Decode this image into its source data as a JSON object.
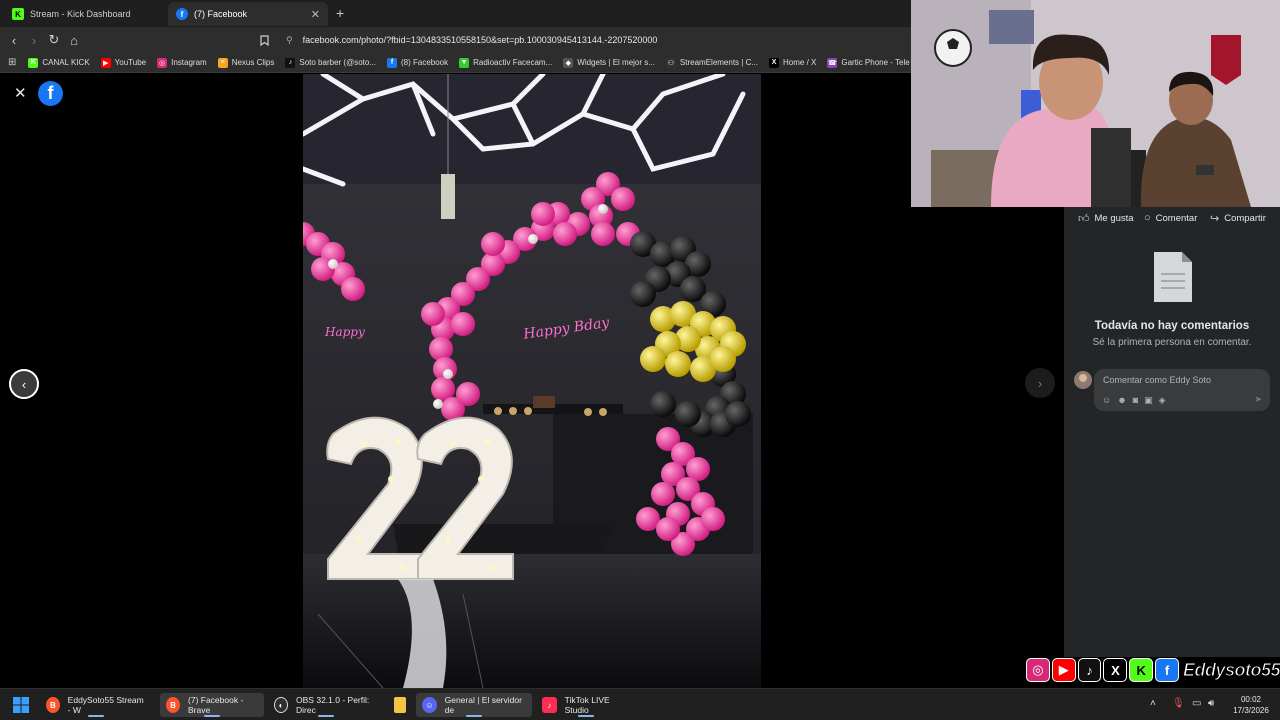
{
  "tabs": [
    {
      "label": "Stream - Kick Dashboard",
      "icon": "kick-icon",
      "color": "#53fc18"
    },
    {
      "label": "(7) Facebook",
      "icon": "facebook-icon",
      "color": "#1877f2"
    }
  ],
  "address": {
    "url": "facebook.com/photo/?fbid=1304833510558150&set=pb.100030945413144.-2207520000"
  },
  "bookmarks": [
    {
      "label": "CANAL KICK",
      "icon": "kick-icon",
      "color": "#53fc18",
      "glyph": "K"
    },
    {
      "label": "YouTube",
      "icon": "youtube-icon",
      "color": "#ff0000",
      "glyph": "▶"
    },
    {
      "label": "Instagram",
      "icon": "instagram-icon",
      "color": "#d62976",
      "glyph": "◎"
    },
    {
      "label": "Nexus Clips",
      "icon": "nexus-icon",
      "color": "#f5a623",
      "glyph": "≡"
    },
    {
      "label": "Soto barber (@soto...",
      "icon": "tiktok-icon",
      "color": "#111111",
      "glyph": "♪"
    },
    {
      "label": "(8) Facebook",
      "icon": "facebook-icon",
      "color": "#1877f2",
      "glyph": "f"
    },
    {
      "label": "Radioactiv Facecam...",
      "icon": "radioactiv-icon",
      "color": "#33cc33",
      "glyph": "▼"
    },
    {
      "label": "Widgets | El mejor s...",
      "icon": "widgets-icon",
      "color": "#555555",
      "glyph": "◆"
    },
    {
      "label": "StreamElements | C...",
      "icon": "streamelements-icon",
      "color": "#333333",
      "glyph": "⚇"
    },
    {
      "label": "Home / X",
      "icon": "x-icon",
      "color": "#000000",
      "glyph": "X"
    },
    {
      "label": "Gartic Phone - Tele",
      "icon": "gartic-icon",
      "color": "#8e44ad",
      "glyph": "☎"
    }
  ],
  "panel": {
    "like": "Me gusta",
    "comment": "Comentar",
    "share": "Compartir",
    "no_comments_title": "Todavía no hay comentarios",
    "no_comments_sub": "Sé la primera persona en comentar.",
    "comment_placeholder": "Comentar como Eddy Soto"
  },
  "overlay": {
    "handle": "Eddysoto55"
  },
  "taskbar": {
    "items": [
      {
        "label": "EddySoto55 Stream - W",
        "icon": "brave-icon",
        "color": "#fb542b"
      },
      {
        "label": "(7) Facebook - Brave",
        "icon": "brave-icon",
        "color": "#fb542b"
      },
      {
        "label": "OBS 32.1.0 - Perfil: Direc",
        "icon": "obs-icon",
        "color": "#302e31"
      },
      {
        "label": "",
        "icon": "folder-icon",
        "color": "#f4c542"
      },
      {
        "label": "General | El servidor de",
        "icon": "discord-icon",
        "color": "#5865f2"
      },
      {
        "label": "TikTok LIVE Studio",
        "icon": "tiktok-icon",
        "color": "#fe2c55"
      }
    ],
    "time": "00:02",
    "date": "17/3/2026"
  }
}
